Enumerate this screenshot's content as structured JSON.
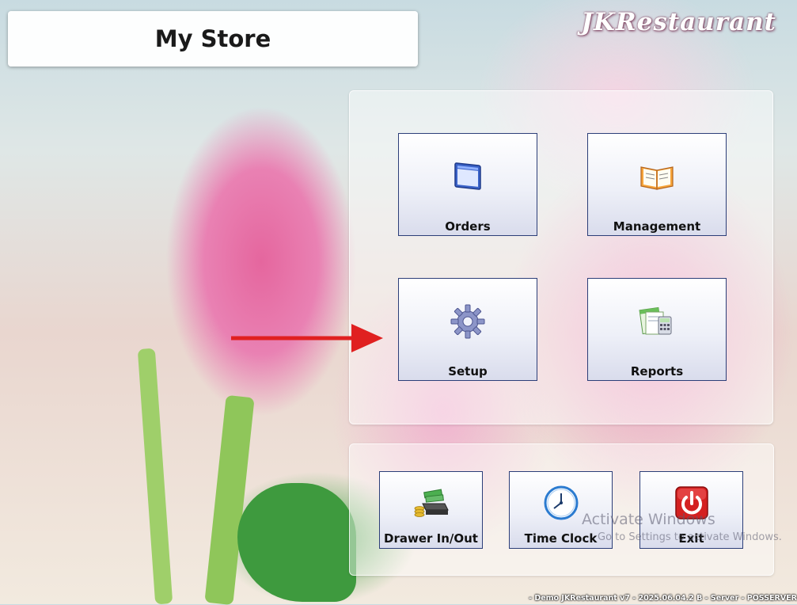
{
  "header": {
    "title": "My Store",
    "brand": "JKRestaurant"
  },
  "main_panel": {
    "buttons": [
      {
        "label": "Orders",
        "icon": "window-icon"
      },
      {
        "label": "Management",
        "icon": "open-book-icon"
      },
      {
        "label": "Setup",
        "icon": "gear-icon"
      },
      {
        "label": "Reports",
        "icon": "calculator-report-icon"
      }
    ]
  },
  "bottom_panel": {
    "buttons": [
      {
        "label": "Drawer In/Out",
        "icon": "cash-drawer-icon"
      },
      {
        "label": "Time Clock",
        "icon": "clock-icon"
      },
      {
        "label": "Exit",
        "icon": "power-icon"
      }
    ]
  },
  "overlay": {
    "activate_title": "Activate Windows",
    "activate_sub": "Go to Settings to activate Windows."
  },
  "status_bar": {
    "text": "- Demo JKRestaurant v7 - 2025.06.04.2 B - Server - POSSERVER"
  },
  "colors": {
    "tile_border": "#2c3e78",
    "arrow": "#e02020",
    "exit_red": "#d42020"
  }
}
